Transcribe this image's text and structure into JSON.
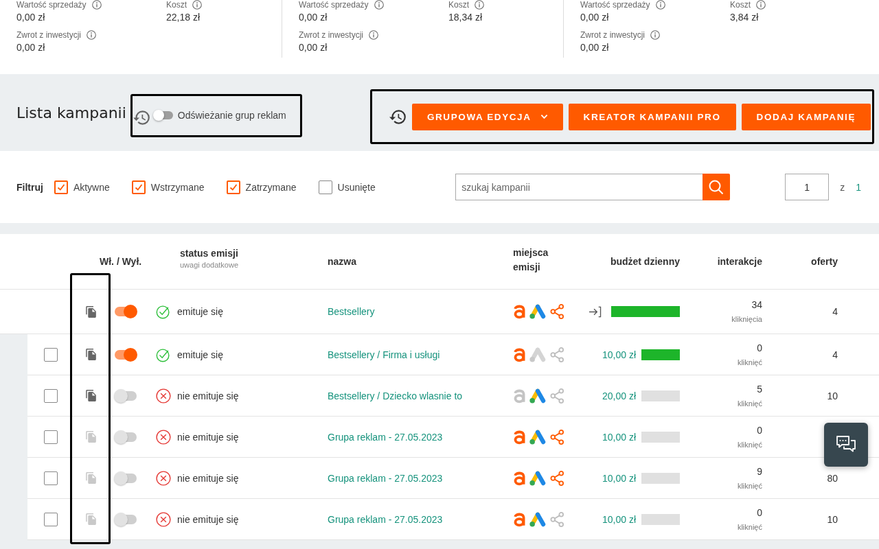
{
  "stats": [
    {
      "items": [
        {
          "label": "Wartość sprzedaży",
          "value": "0,00 zł"
        },
        {
          "label": "Koszt",
          "value": "22,18 zł"
        },
        {
          "label": "Zwrot z inwestycji",
          "value": "0,00 zł"
        }
      ]
    },
    {
      "items": [
        {
          "label": "Wartość sprzedaży",
          "value": "0,00 zł"
        },
        {
          "label": "Koszt",
          "value": "18,34 zł"
        },
        {
          "label": "Zwrot z inwestycji",
          "value": "0,00 zł"
        }
      ]
    },
    {
      "items": [
        {
          "label": "Wartość sprzedaży",
          "value": "0,00 zł"
        },
        {
          "label": "Koszt",
          "value": "3,84 zł"
        },
        {
          "label": "Zwrot z inwestycji",
          "value": "0,00 zł"
        }
      ]
    }
  ],
  "header": {
    "title": "Lista kampanii",
    "refresh": {
      "label": "Odświeżanie grup reklam",
      "on": false,
      "framed": true
    },
    "toolbar": {
      "framed": true,
      "buttons": [
        {
          "label": "GRUPOWA EDYCJA",
          "dropdown": true
        },
        {
          "label": "KREATOR KAMPANII PRO",
          "dropdown": false
        },
        {
          "label": "DODAJ KAMPANIĘ",
          "dropdown": false
        }
      ]
    }
  },
  "filters": {
    "label": "Filtruj",
    "options": [
      {
        "label": "Aktywne",
        "checked": true
      },
      {
        "label": "Wstrzymane",
        "checked": true
      },
      {
        "label": "Zatrzymane",
        "checked": true
      },
      {
        "label": "Usunięte",
        "checked": false
      }
    ],
    "search": {
      "placeholder": "szukaj kampanii"
    },
    "pager": {
      "page": "1",
      "separator": "z",
      "total": "1"
    }
  },
  "table": {
    "copy_column_framed": true,
    "columns": [
      {
        "label": "Wł. / Wył."
      },
      {
        "label": "status emisji",
        "note": "uwagi dodatkowe"
      },
      {
        "label": "nazwa"
      },
      {
        "label": "miejsca emisji"
      },
      {
        "label": "budżet dzienny"
      },
      {
        "label": "interakcje"
      },
      {
        "label": "oferty"
      }
    ],
    "rows": [
      {
        "copy_disabled": false,
        "on": true,
        "emitting": true,
        "status": "emituje się",
        "name": "Bestsellery",
        "placements": [
          {
            "kind": "letter",
            "active": true
          },
          {
            "kind": "peak",
            "active": true
          },
          {
            "kind": "share",
            "active": true
          }
        ],
        "budget": {
          "kind": "linked",
          "level": 1
        },
        "interactions": {
          "value": "34",
          "unit": "kliknięcia"
        },
        "offers": "4",
        "children": [
          {
            "checked": false,
            "copy_disabled": false,
            "on": true,
            "emitting": true,
            "status": "emituje się",
            "name": "Bestsellery / Firma i usługi",
            "placements": [
              {
                "kind": "letter",
                "active": true
              },
              {
                "kind": "peak",
                "active": false
              },
              {
                "kind": "share",
                "active": false
              }
            ],
            "budget": {
              "kind": "amount",
              "amount": "10,00 zł",
              "level": 1
            },
            "interactions": {
              "value": "0",
              "unit": "kliknięć"
            },
            "offers": "4"
          },
          {
            "checked": false,
            "copy_disabled": false,
            "on": false,
            "emitting": false,
            "status": "nie emituje się",
            "name": "Bestsellery / Dziecko wlasnie to",
            "placements": [
              {
                "kind": "letter",
                "active": false
              },
              {
                "kind": "peak",
                "active": true
              },
              {
                "kind": "share",
                "active": false
              }
            ],
            "budget": {
              "kind": "amount",
              "amount": "20,00 zł",
              "level": 0
            },
            "interactions": {
              "value": "5",
              "unit": "kliknięć"
            },
            "offers": "10"
          },
          {
            "checked": false,
            "copy_disabled": true,
            "on": false,
            "emitting": false,
            "status": "nie emituje się",
            "name": "Grupa reklam - 27.05.2023",
            "placements": [
              {
                "kind": "letter",
                "active": true
              },
              {
                "kind": "peak",
                "active": true
              },
              {
                "kind": "share",
                "active": true
              }
            ],
            "budget": {
              "kind": "amount",
              "amount": "10,00 zł",
              "level": 0
            },
            "interactions": {
              "value": "0",
              "unit": "kliknięć"
            }
          },
          {
            "checked": false,
            "copy_disabled": true,
            "on": false,
            "emitting": false,
            "status": "nie emituje się",
            "name": "Grupa reklam - 27.05.2023",
            "placements": [
              {
                "kind": "letter",
                "active": true
              },
              {
                "kind": "peak",
                "active": true
              },
              {
                "kind": "share",
                "active": true
              }
            ],
            "budget": {
              "kind": "amount",
              "amount": "10,00 zł",
              "level": 0
            },
            "interactions": {
              "value": "9",
              "unit": "kliknięć"
            },
            "offers": "80"
          },
          {
            "checked": false,
            "copy_disabled": true,
            "on": false,
            "emitting": false,
            "status": "nie emituje się",
            "name": "Grupa reklam - 27.05.2023",
            "placements": [
              {
                "kind": "letter",
                "active": true
              },
              {
                "kind": "peak",
                "active": true
              },
              {
                "kind": "share",
                "active": false
              }
            ],
            "budget": {
              "kind": "amount",
              "amount": "10,00 zł",
              "level": 0
            },
            "interactions": {
              "value": "0",
              "unit": "kliknięć"
            },
            "offers": "10"
          }
        ]
      }
    ]
  }
}
